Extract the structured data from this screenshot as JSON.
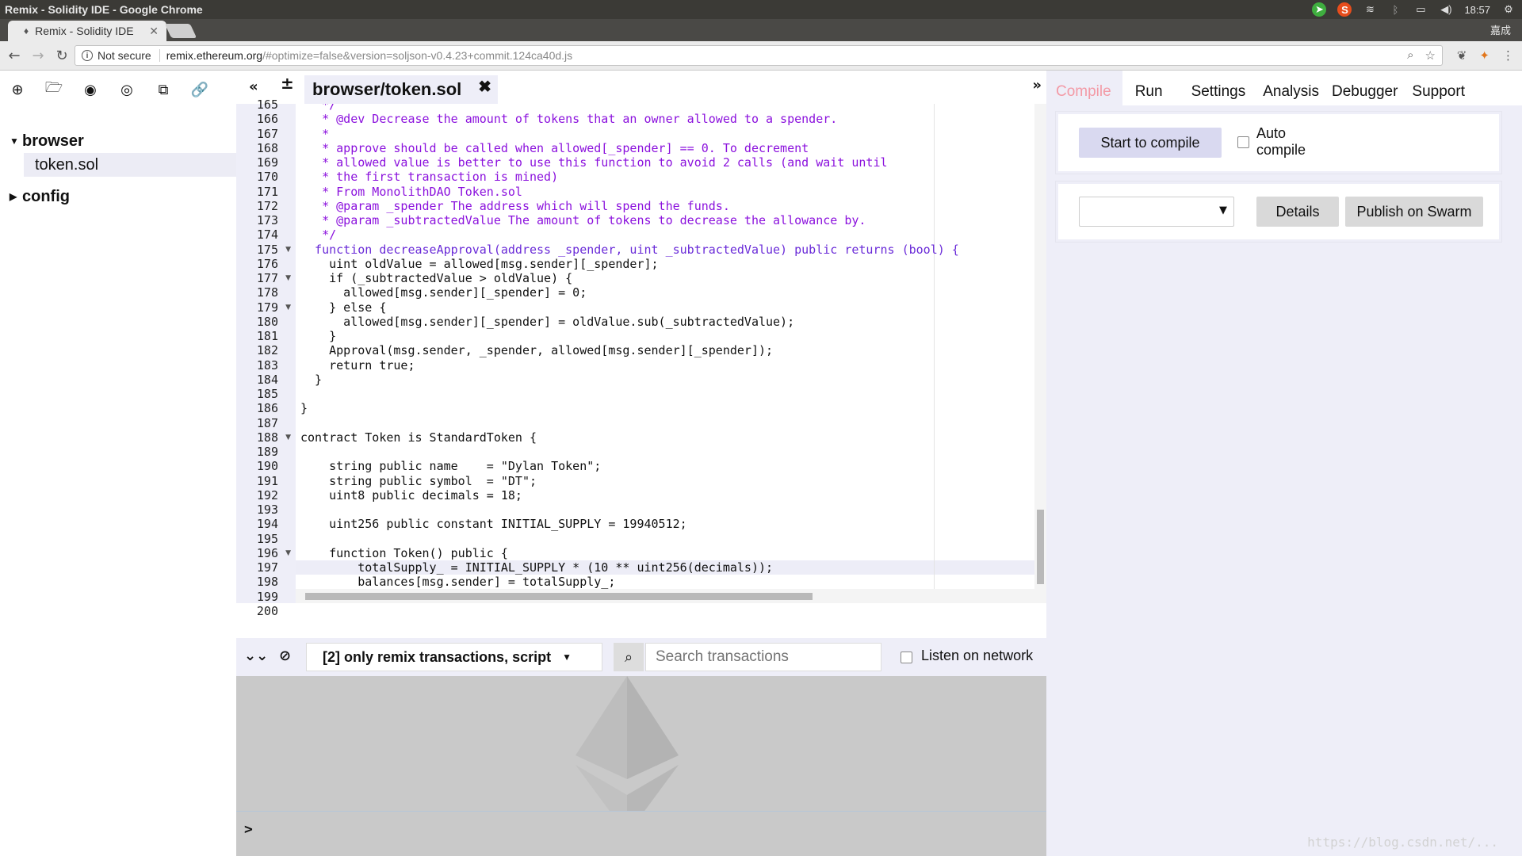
{
  "os": {
    "window_title": "Remix - Solidity IDE - Google Chrome",
    "clock": "18:57"
  },
  "browser": {
    "tab_title": "Remix - Solidity IDE",
    "user_name": "嘉成",
    "security_label": "Not secure",
    "url_host": "remix.ethereum.org",
    "url_path": "/#optimize=false&version=soljson-v0.4.23+commit.124ca40d.js"
  },
  "file_explorer": {
    "folders": [
      {
        "name": "browser",
        "expanded": true,
        "files": [
          "token.sol"
        ]
      },
      {
        "name": "config",
        "expanded": false,
        "files": []
      }
    ]
  },
  "editor": {
    "active_tab": "browser/token.sol",
    "highlighted_line": 197,
    "lines": [
      {
        "n": "165",
        "text": "   */",
        "cls": "cm",
        "fold": false
      },
      {
        "n": "166",
        "text": "   * @dev Decrease the amount of tokens that an owner allowed to a spender.",
        "cls": "cm",
        "fold": false
      },
      {
        "n": "167",
        "text": "   *",
        "cls": "cm",
        "fold": false
      },
      {
        "n": "168",
        "text": "   * approve should be called when allowed[_spender] == 0. To decrement",
        "cls": "cm",
        "fold": false
      },
      {
        "n": "169",
        "text": "   * allowed value is better to use this function to avoid 2 calls (and wait until",
        "cls": "cm",
        "fold": false
      },
      {
        "n": "170",
        "text": "   * the first transaction is mined)",
        "cls": "cm",
        "fold": false
      },
      {
        "n": "171",
        "text": "   * From MonolithDAO Token.sol",
        "cls": "cm",
        "fold": false
      },
      {
        "n": "172",
        "text": "   * @param _spender The address which will spend the funds.",
        "cls": "cm",
        "fold": false
      },
      {
        "n": "173",
        "text": "   * @param _subtractedValue The amount of tokens to decrease the allowance by.",
        "cls": "cm",
        "fold": false
      },
      {
        "n": "174",
        "text": "   */",
        "cls": "cm",
        "fold": false
      },
      {
        "n": "175",
        "text": "  function decreaseApproval(address _spender, uint _subtractedValue) public returns (bool) {",
        "cls": "kw",
        "fold": true
      },
      {
        "n": "176",
        "text": "    uint oldValue = allowed[msg.sender][_spender];",
        "cls": "",
        "fold": false
      },
      {
        "n": "177",
        "text": "    if (_subtractedValue > oldValue) {",
        "cls": "",
        "fold": true
      },
      {
        "n": "178",
        "text": "      allowed[msg.sender][_spender] = 0;",
        "cls": "",
        "fold": false
      },
      {
        "n": "179",
        "text": "    } else {",
        "cls": "",
        "fold": true
      },
      {
        "n": "180",
        "text": "      allowed[msg.sender][_spender] = oldValue.sub(_subtractedValue);",
        "cls": "",
        "fold": false
      },
      {
        "n": "181",
        "text": "    }",
        "cls": "",
        "fold": false
      },
      {
        "n": "182",
        "text": "    Approval(msg.sender, _spender, allowed[msg.sender][_spender]);",
        "cls": "",
        "fold": false
      },
      {
        "n": "183",
        "text": "    return true;",
        "cls": "",
        "fold": false
      },
      {
        "n": "184",
        "text": "  }",
        "cls": "",
        "fold": false
      },
      {
        "n": "185",
        "text": "",
        "cls": "",
        "fold": false
      },
      {
        "n": "186",
        "text": "}",
        "cls": "",
        "fold": false
      },
      {
        "n": "187",
        "text": "",
        "cls": "",
        "fold": false
      },
      {
        "n": "188",
        "text": "contract Token is StandardToken {",
        "cls": "",
        "fold": true
      },
      {
        "n": "189",
        "text": "",
        "cls": "",
        "fold": false
      },
      {
        "n": "190",
        "text": "    string public name    = \"Dylan Token\";",
        "cls": "",
        "fold": false
      },
      {
        "n": "191",
        "text": "    string public symbol  = \"DT\";",
        "cls": "",
        "fold": false
      },
      {
        "n": "192",
        "text": "    uint8 public decimals = 18;",
        "cls": "",
        "fold": false
      },
      {
        "n": "193",
        "text": "",
        "cls": "",
        "fold": false
      },
      {
        "n": "194",
        "text": "    uint256 public constant INITIAL_SUPPLY = 19940512;",
        "cls": "",
        "fold": false
      },
      {
        "n": "195",
        "text": "",
        "cls": "",
        "fold": false
      },
      {
        "n": "196",
        "text": "    function Token() public {",
        "cls": "",
        "fold": true
      },
      {
        "n": "197",
        "text": "        totalSupply_ = INITIAL_SUPPLY * (10 ** uint256(decimals));",
        "cls": "",
        "fold": false
      },
      {
        "n": "198",
        "text": "        balances[msg.sender] = totalSupply_;",
        "cls": "",
        "fold": false
      },
      {
        "n": "199",
        "text": "    }",
        "cls": "",
        "fold": false
      },
      {
        "n": "200",
        "text": "}",
        "cls": "",
        "fold": false
      }
    ]
  },
  "terminal": {
    "filter_label": "[2] only remix transactions, script",
    "search_placeholder": "Search transactions",
    "listen_label": "Listen on network",
    "prompt": ">"
  },
  "right_panel": {
    "tabs": [
      "Compile",
      "Run",
      "Settings",
      "Analysis",
      "Debugger",
      "Support"
    ],
    "active_tab": "Compile",
    "compile_button": "Start to compile",
    "auto_compile_label": "Auto compile",
    "details_button": "Details",
    "publish_button": "Publish on Swarm"
  },
  "watermark": "https://blog.csdn.net/...",
  "colors": {
    "accent_tab": "#f39aa6",
    "panel_bg": "#eeeef8",
    "comment": "#8b11dd",
    "keyword": "#6a2bd8",
    "string": "#1a7a1a"
  }
}
